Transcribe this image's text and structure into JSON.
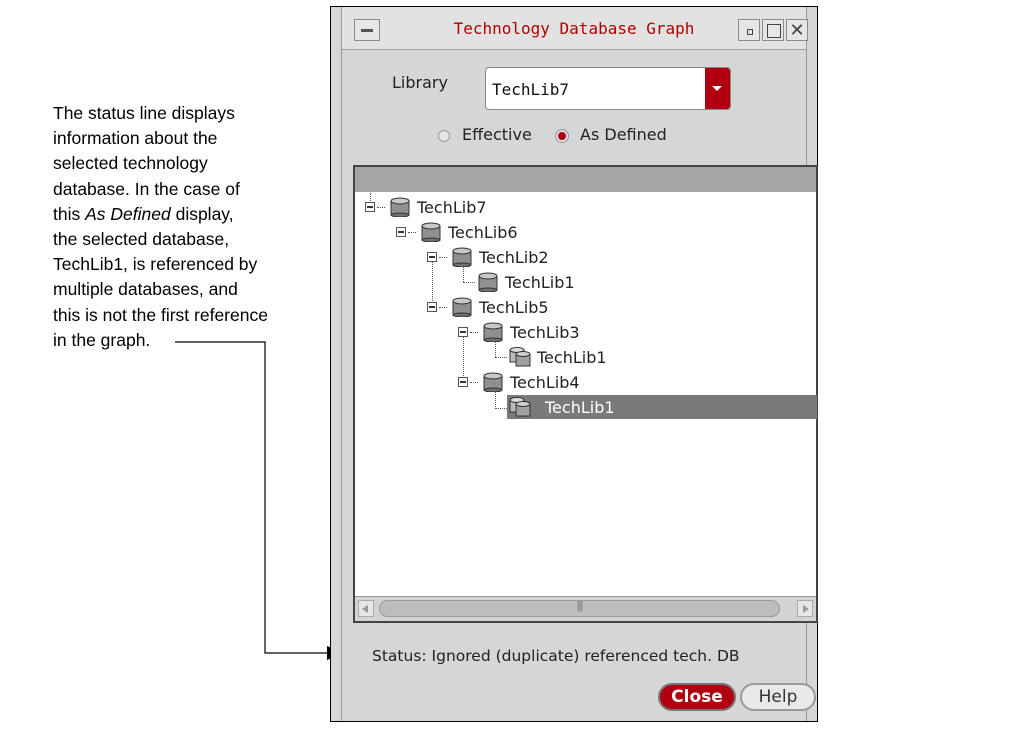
{
  "callout": {
    "lines": [
      "The status line displays",
      "information about the",
      "selected technology",
      "database. In the case of"
    ],
    "line5_pre": "this ",
    "line5_italic": "As Defined",
    "line5_post": " display,",
    "lines_rest": [
      "the selected database,",
      "TechLib1, is referenced by",
      "multiple databases, and",
      "this is not the first reference",
      "in the graph."
    ]
  },
  "window": {
    "title": "Technology Database Graph",
    "library_label": "Library",
    "library_value": "TechLib7",
    "radio_effective": "Effective",
    "radio_as_defined": "As Defined",
    "selected_radio": "As Defined"
  },
  "tree": {
    "nodes": [
      {
        "label": "TechLib7",
        "icon": "database-icon"
      },
      {
        "label": "TechLib6",
        "icon": "database-icon"
      },
      {
        "label": "TechLib2",
        "icon": "database-icon"
      },
      {
        "label": "TechLib1",
        "icon": "database-icon"
      },
      {
        "label": "TechLib5",
        "icon": "database-icon"
      },
      {
        "label": "TechLib3",
        "icon": "database-icon"
      },
      {
        "label": "TechLib1",
        "icon": "database-reference-icon"
      },
      {
        "label": "TechLib4",
        "icon": "database-icon"
      },
      {
        "label": "TechLib1",
        "icon": "database-reference-icon",
        "selected": true
      }
    ]
  },
  "status": "Status: Ignored (duplicate) referenced tech. DB",
  "buttons": {
    "close": "Close",
    "help": "Help"
  },
  "colors": {
    "accent_red": "#b00010",
    "selection_gray": "#7a7a7a"
  }
}
